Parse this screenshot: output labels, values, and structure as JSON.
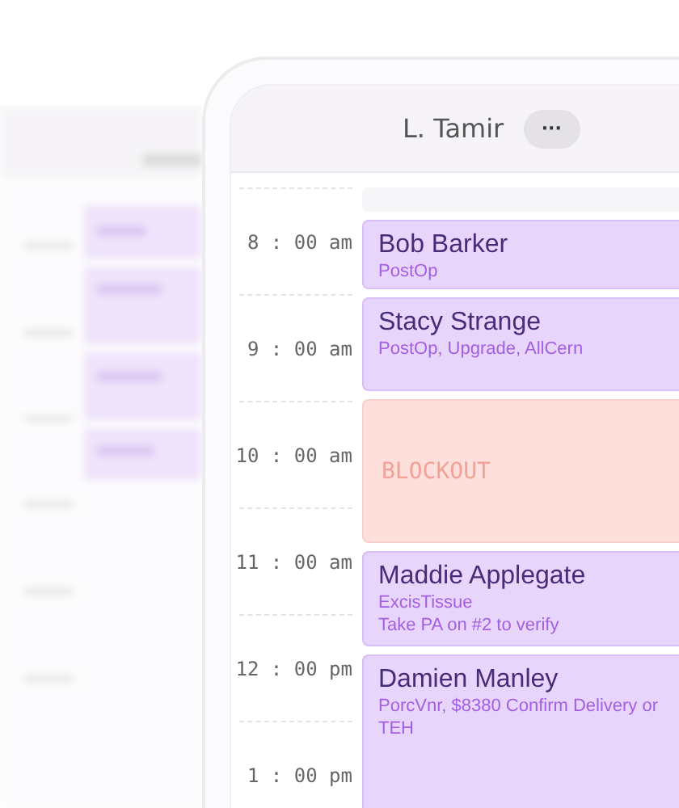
{
  "header": {
    "title": "L. Tamir",
    "menu_button": "···"
  },
  "times": [
    "8 : 00 am",
    "9 : 00 am",
    "10 : 00 am",
    "11 : 00 am",
    "12 : 00 pm",
    "1 : 00 pm"
  ],
  "events": [
    {
      "kind": "empty"
    },
    {
      "kind": "appointment",
      "name": "Bob Barker",
      "details": [
        "PostOp"
      ]
    },
    {
      "kind": "appointment",
      "name": "Stacy Strange",
      "details": [
        "PostOp, Upgrade, AllCern"
      ]
    },
    {
      "kind": "blockout",
      "label": "BLOCKOUT"
    },
    {
      "kind": "appointment",
      "name": "Maddie Applegate",
      "details": [
        "ExcisTissue",
        "Take PA on #2 to verify"
      ]
    },
    {
      "kind": "appointment",
      "name": "Damien Manley",
      "details": [
        "PorcVnr, $8380 Confirm Delivery or",
        "TEH"
      ]
    }
  ]
}
